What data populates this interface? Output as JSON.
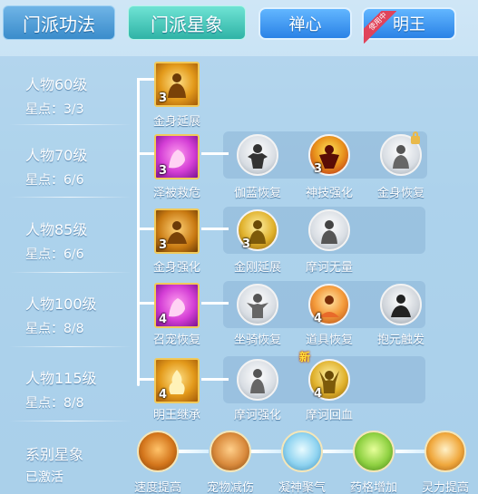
{
  "tabs": {
    "main": [
      {
        "label": "门派功法",
        "active": false
      },
      {
        "label": "门派星象",
        "active": true
      }
    ],
    "sub": [
      {
        "label": "禅心"
      },
      {
        "label": "明王",
        "badge": "使用中"
      }
    ]
  },
  "rows": [
    {
      "level": "人物60级",
      "stars": "星点：3/3"
    },
    {
      "level": "人物70级",
      "stars": "星点：6/6"
    },
    {
      "level": "人物85级",
      "stars": "星点：6/6"
    },
    {
      "level": "人物100级",
      "stars": "星点：8/8"
    },
    {
      "level": "人物115级",
      "stars": "星点：8/8"
    }
  ],
  "skills": {
    "r1_main": {
      "name": "金身延展",
      "count": "3"
    },
    "r2_main": {
      "name": "泽被救危",
      "count": "3"
    },
    "r2_a": {
      "name": "伽蓝恢复"
    },
    "r2_b": {
      "name": "神技强化",
      "count": "3"
    },
    "r2_c": {
      "name": "金身恢复"
    },
    "r3_main": {
      "name": "金身强化",
      "count": "3"
    },
    "r3_a": {
      "name": "金刚延展",
      "count": "3"
    },
    "r3_b": {
      "name": "摩诃无量"
    },
    "r4_main": {
      "name": "召宠恢复",
      "count": "4"
    },
    "r4_a": {
      "name": "坐骑恢复"
    },
    "r4_b": {
      "name": "道具恢复",
      "count": "4"
    },
    "r4_c": {
      "name": "抱元触发"
    },
    "r5_main": {
      "name": "明王继承",
      "count": "4"
    },
    "r5_a": {
      "name": "摩诃强化"
    },
    "r5_b": {
      "name": "摩诃回血",
      "count": "4",
      "tag": "新"
    }
  },
  "series": {
    "title": "系别星象",
    "state": "已激活",
    "items": [
      {
        "name": "速度提高"
      },
      {
        "name": "宠物减伤"
      },
      {
        "name": "凝神聚气"
      },
      {
        "name": "药格增加"
      },
      {
        "name": "灵力提高"
      }
    ]
  }
}
